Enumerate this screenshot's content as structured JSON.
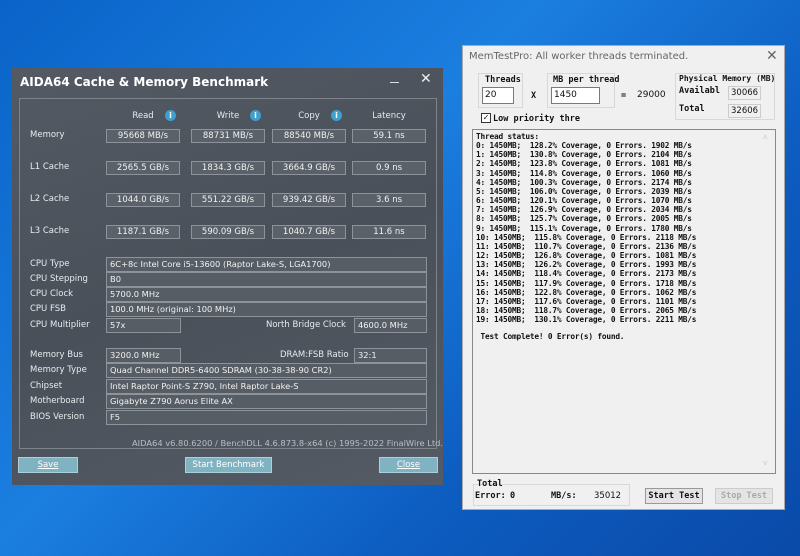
{
  "aida": {
    "title": "AIDA64 Cache & Memory Benchmark",
    "columns": [
      "Read",
      "Write",
      "Copy",
      "Latency"
    ],
    "rows": [
      {
        "label": "Memory",
        "values": [
          "95668 MB/s",
          "88731 MB/s",
          "88540 MB/s",
          "59.1 ns"
        ]
      },
      {
        "label": "L1 Cache",
        "values": [
          "2565.5 GB/s",
          "1834.3 GB/s",
          "3664.9 GB/s",
          "0.9 ns"
        ]
      },
      {
        "label": "L2 Cache",
        "values": [
          "1044.0 GB/s",
          "551.22 GB/s",
          "939.42 GB/s",
          "3.6 ns"
        ]
      },
      {
        "label": "L3 Cache",
        "values": [
          "1187.1 GB/s",
          "590.09 GB/s",
          "1040.7 GB/s",
          "11.6 ns"
        ]
      }
    ],
    "cpu_type": {
      "label": "CPU Type",
      "value": "6C+8c Intel Core i5-13600  (Raptor Lake-S, LGA1700)"
    },
    "cpu_stepping": {
      "label": "CPU Stepping",
      "value": "B0"
    },
    "cpu_clock": {
      "label": "CPU Clock",
      "value": "5700.0 MHz"
    },
    "cpu_fsb": {
      "label": "CPU FSB",
      "value": "100.0 MHz  (original: 100 MHz)"
    },
    "cpu_multiplier": {
      "label": "CPU Multiplier",
      "value": "57x"
    },
    "nb_clock": {
      "label": "North Bridge Clock",
      "value": "4600.0 MHz"
    },
    "memory_bus": {
      "label": "Memory Bus",
      "value": "3200.0 MHz"
    },
    "dram_ratio": {
      "label": "DRAM:FSB Ratio",
      "value": "32:1"
    },
    "memory_type": {
      "label": "Memory Type",
      "value": "Quad Channel DDR5-6400 SDRAM  (30-38-38-90 CR2)"
    },
    "chipset": {
      "label": "Chipset",
      "value": "Intel Raptor Point-S Z790, Intel Raptor Lake-S"
    },
    "motherboard": {
      "label": "Motherboard",
      "value": "Gigabyte Z790 Aorus Elite AX"
    },
    "bios": {
      "label": "BIOS Version",
      "value": "F5"
    },
    "footer": "AIDA64 v6.80.6200 / BenchDLL 4.6.873.8-x64  (c) 1995-2022 FinalWire Ltd.",
    "save": "Save",
    "start": "Start Benchmark",
    "close": "Close"
  },
  "memtest": {
    "title": "MemTestPro: All worker threads terminated.",
    "threads_label": "Threads",
    "threads": "20",
    "x": "X",
    "mb_label": "MB per thread",
    "mb": "1450",
    "eq": "=",
    "total_mb": "29000",
    "phys_label": "Physical Memory (MB)",
    "avail_label": "Availabl",
    "avail": "30066",
    "total_label": "Total",
    "total": "32606",
    "low_priority": "Low priority thre",
    "log_header": "Thread status:",
    "threads_status": [
      "0: 1450MB;  128.2% Coverage, 0 Errors. 1902 MB/s",
      "1: 1450MB;  130.8% Coverage, 0 Errors. 2104 MB/s",
      "2: 1450MB;  123.8% Coverage, 0 Errors. 1081 MB/s",
      "3: 1450MB;  114.8% Coverage, 0 Errors. 1060 MB/s",
      "4: 1450MB;  100.3% Coverage, 0 Errors. 2174 MB/s",
      "5: 1450MB;  106.0% Coverage, 0 Errors. 2039 MB/s",
      "6: 1450MB;  120.1% Coverage, 0 Errors. 1070 MB/s",
      "7: 1450MB;  126.9% Coverage, 0 Errors. 2034 MB/s",
      "8: 1450MB;  125.7% Coverage, 0 Errors. 2005 MB/s",
      "9: 1450MB;  115.1% Coverage, 0 Errors. 1780 MB/s",
      "10: 1450MB;  115.8% Coverage, 0 Errors. 2118 MB/s",
      "11: 1450MB;  110.7% Coverage, 0 Errors. 2136 MB/s",
      "12: 1450MB;  126.8% Coverage, 0 Errors. 1081 MB/s",
      "13: 1450MB;  126.2% Coverage, 0 Errors. 1993 MB/s",
      "14: 1450MB;  118.4% Coverage, 0 Errors. 2173 MB/s",
      "15: 1450MB;  117.9% Coverage, 0 Errors. 1718 MB/s",
      "16: 1450MB;  122.8% Coverage, 0 Errors. 1062 MB/s",
      "17: 1450MB;  117.6% Coverage, 0 Errors. 1101 MB/s",
      "18: 1450MB;  118.7% Coverage, 0 Errors. 2065 MB/s",
      "19: 1450MB;  130.1% Coverage, 0 Errors. 2211 MB/s"
    ],
    "complete": " Test Complete! 0 Error(s) found.",
    "total_group": "Total",
    "error_label": "Error:",
    "errors": "0",
    "mbs_label": "MB/s:",
    "mbs": "35012",
    "start": "Start Test",
    "stop": "Stop Test"
  }
}
